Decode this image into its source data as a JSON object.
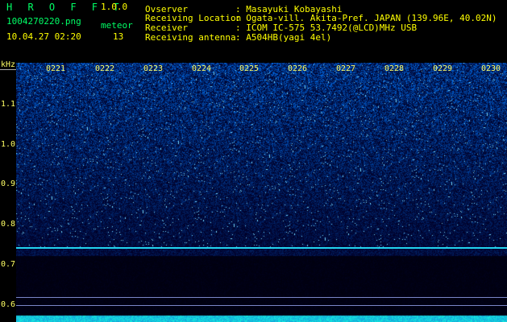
{
  "header": {
    "app_title": "H R O F F T",
    "version": "1.0.0",
    "filename": "1004270220.png",
    "meteor_label": "meteor",
    "meteor_count": "13",
    "datetime": "10.04.27 02:20"
  },
  "info": {
    "observer_label": "Ovserver",
    "observer_value": ": Masayuki Kobayashi",
    "location_label": "Receiving Location",
    "location_value": ": Ogata-vill. Akita-Pref. JAPAN (139.96E, 40.02N)",
    "receiver_label": "Receiver",
    "receiver_value": ": ICOM IC-575 53.7492(@LCD)MHz USB",
    "antenna_label": "Receiving antenna",
    "antenna_value": ": A504HB(yagi 4el)"
  },
  "axis": {
    "unit": "kHz",
    "y_labels": [
      "1.1",
      "1.0",
      "0.9",
      "0.8",
      "0.7",
      "0.6"
    ],
    "time_labels": [
      "0221",
      "0222",
      "0223",
      "0224",
      "0225",
      "0226",
      "0227",
      "0228",
      "0229",
      "0230"
    ]
  },
  "colors": {
    "background": "#000000",
    "spectrogram_dark": "#000033",
    "spectrogram_bright": "#3a5cff",
    "label_yellow": "#ffff00",
    "label_green": "#00ff66",
    "carrier_cyan": "#22d3ee"
  }
}
